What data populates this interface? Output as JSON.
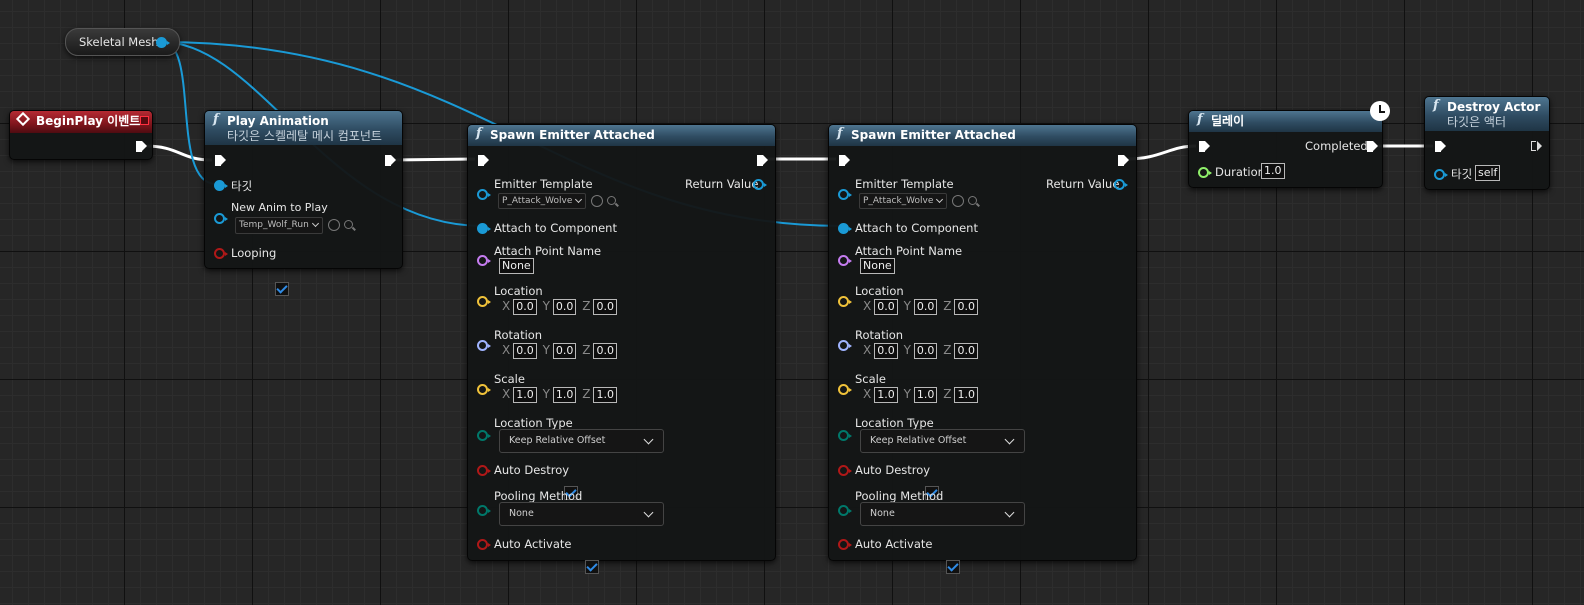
{
  "colors": {
    "object_pin": "#1a9ad6",
    "exec_pin": "#ffffff",
    "event_header": "#9b1f28",
    "function_header": "#3a5c74",
    "float_pin": "#8ff06a",
    "rotator_pin": "#a0b4ff",
    "vector_pin": "#f0c23a",
    "name_pin": "#c57cf0",
    "bool_pin": "#b01818",
    "enum_pin": "#00786a"
  },
  "nodes": {
    "skeletal_mesh": {
      "label": "Skeletal Mesh"
    },
    "begin_play": {
      "title": "BeginPlay 이벤트"
    },
    "play_animation": {
      "title": "Play Animation",
      "subtitle": "타깃은 스켈레탈 메시 컴포넌트",
      "target": "타깃",
      "new_anim": "New Anim to Play",
      "anim_asset": "Temp_Wolf_Run",
      "looping": "Looping"
    },
    "spawn1": {
      "title": "Spawn Emitter Attached",
      "emitter_template": "Emitter Template",
      "emitter_asset": "P_Attack_Wolve",
      "return_value": "Return Value",
      "attach_to": "Attach to Component",
      "attach_point": "Attach Point Name",
      "attach_point_value": "None",
      "location": "Location",
      "rotation": "Rotation",
      "scale": "Scale",
      "loc": [
        "0.0",
        "0.0",
        "0.0"
      ],
      "rot": [
        "0.0",
        "0.0",
        "0.0"
      ],
      "scl": [
        "1.0",
        "1.0",
        "1.0"
      ],
      "location_type": "Location Type",
      "location_type_value": "Keep Relative Offset",
      "auto_destroy": "Auto Destroy",
      "pooling_method": "Pooling Method",
      "pooling_value": "None",
      "auto_activate": "Auto Activate"
    },
    "spawn2": {
      "title": "Spawn Emitter Attached",
      "emitter_template": "Emitter Template",
      "emitter_asset": "P_Attack_Wolve",
      "return_value": "Return Value",
      "attach_to": "Attach to Component",
      "attach_point": "Attach Point Name",
      "attach_point_value": "None",
      "location": "Location",
      "rotation": "Rotation",
      "scale": "Scale",
      "loc": [
        "0.0",
        "0.0",
        "0.0"
      ],
      "rot": [
        "0.0",
        "0.0",
        "0.0"
      ],
      "scl": [
        "1.0",
        "1.0",
        "1.0"
      ],
      "location_type": "Location Type",
      "location_type_value": "Keep Relative Offset",
      "auto_destroy": "Auto Destroy",
      "pooling_method": "Pooling Method",
      "pooling_value": "None",
      "auto_activate": "Auto Activate"
    },
    "delay": {
      "title": "딜레이",
      "completed": "Completed",
      "duration": "Duration",
      "duration_value": "1.0"
    },
    "destroy_actor": {
      "title": "Destroy Actor",
      "subtitle": "타깃은 액터",
      "target": "타깃",
      "target_value": "self"
    }
  },
  "axes": {
    "x": "X",
    "y": "Y",
    "z": "Z"
  }
}
